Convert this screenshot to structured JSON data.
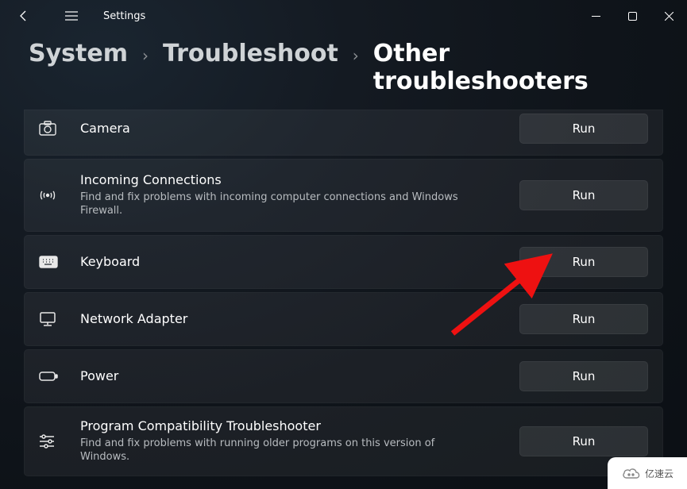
{
  "app": {
    "title": "Settings"
  },
  "breadcrumb": {
    "system": "System",
    "troubleshoot": "Troubleshoot",
    "current": "Other troubleshooters"
  },
  "buttons": {
    "run": "Run"
  },
  "items": [
    {
      "title": "Camera",
      "desc": ""
    },
    {
      "title": "Incoming Connections",
      "desc": "Find and fix problems with incoming computer connections and Windows Firewall."
    },
    {
      "title": "Keyboard",
      "desc": ""
    },
    {
      "title": "Network Adapter",
      "desc": ""
    },
    {
      "title": "Power",
      "desc": ""
    },
    {
      "title": "Program Compatibility Troubleshooter",
      "desc": "Find and fix problems with running older programs on this version of Windows."
    }
  ],
  "watermark": {
    "text": "亿速云"
  },
  "annotation": {
    "arrow_target": "keyboard-run-button"
  }
}
